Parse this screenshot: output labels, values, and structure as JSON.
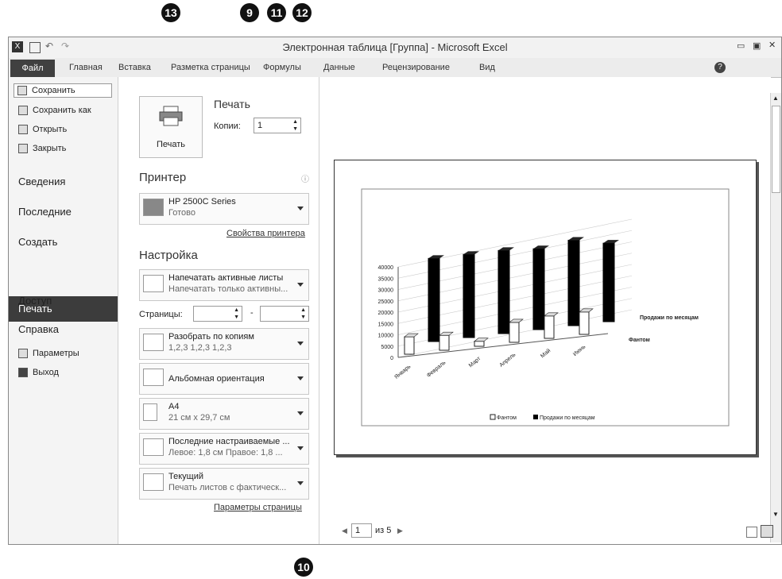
{
  "callouts": {
    "c13": "13",
    "c9": "9",
    "c11": "11",
    "c12": "12",
    "c10": "10"
  },
  "window": {
    "title": "Электронная таблица [Группа] - Microsoft Excel"
  },
  "ribbon": {
    "file": "Файл",
    "tabs": [
      "Главная",
      "Вставка",
      "Разметка страницы",
      "Формулы",
      "Данные",
      "Рецензирование",
      "Вид"
    ]
  },
  "nav": {
    "small1": [
      "Сохранить",
      "Сохранить как",
      "Открыть",
      "Закрыть"
    ],
    "big": [
      "Сведения",
      "Последние",
      "Создать",
      "Печать",
      "Доступ",
      "Справка"
    ],
    "small2": [
      "Параметры",
      "Выход"
    ]
  },
  "print": {
    "button": "Печать",
    "heading": "Печать",
    "copies_label": "Копии:",
    "copies_value": "1",
    "printer_heading": "Принтер",
    "printer_name": "HP 2500C Series",
    "printer_status": "Готово",
    "printer_props": "Свойства принтера",
    "settings_heading": "Настройка",
    "pages_label": "Страницы:",
    "pages_dash": "-",
    "page_setup": "Параметры страницы"
  },
  "settings": [
    {
      "main": "Напечатать активные листы",
      "sub": "Напечатать только активны..."
    },
    {
      "main": "Разобрать по копиям",
      "sub": "1,2,3   1,2,3   1,2,3"
    },
    {
      "main": "Альбомная ориентация",
      "sub": ""
    },
    {
      "main": "A4",
      "sub": "21 см x 29,7 см"
    },
    {
      "main": "Последние настраиваемые ...",
      "sub": "Левое: 1,8 см   Правое: 1,8 ..."
    },
    {
      "main": "Текущий",
      "sub": "Печать листов с фактическ..."
    }
  ],
  "preview": {
    "page_value": "1",
    "page_of": "из 5"
  },
  "chart_data": {
    "type": "bar",
    "categories": [
      "Январь",
      "Февраль",
      "Март",
      "Апрель",
      "Май",
      "Июнь"
    ],
    "series": [
      {
        "name": "Фантом",
        "values": [
          3500,
          3000,
          1000,
          4000,
          4500,
          4500
        ]
      },
      {
        "name": "Продажи по месяцам",
        "values": [
          36000,
          36000,
          36000,
          35000,
          37000,
          34000
        ]
      }
    ],
    "ylim": [
      0,
      40000
    ],
    "yticks": [
      "40000",
      "35000",
      "30000",
      "25000",
      "20000",
      "15000",
      "10000",
      "5000",
      "0"
    ],
    "depth_labels": [
      "Продажи по месяцам",
      "Фантом"
    ],
    "grid": true,
    "legend": "bottom",
    "colors": {
      "Фантом": "#ffffff",
      "Продажи по месяцам": "#000000"
    }
  }
}
